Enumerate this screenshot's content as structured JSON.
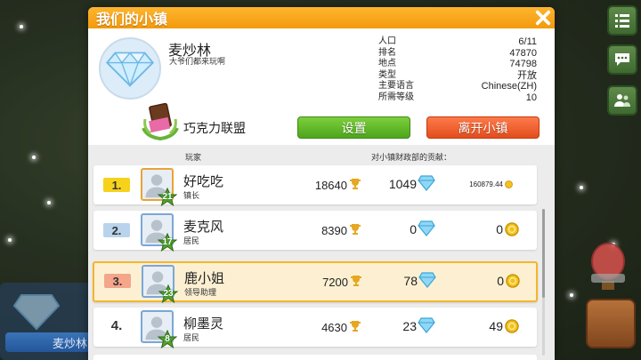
{
  "dialog": {
    "title": "我们的小镇"
  },
  "town": {
    "name": "麦炒林",
    "motto": "大爷们都来玩啊",
    "stats": [
      {
        "label": "人口",
        "value": "6/11"
      },
      {
        "label": "排名",
        "value": "47870"
      },
      {
        "label": "地点",
        "value": "74798"
      },
      {
        "label": "类型",
        "value": "开放"
      },
      {
        "label": "主要语言",
        "value": "Chinese(ZH)"
      },
      {
        "label": "所需等级",
        "value": "10"
      }
    ],
    "alliance": "巧克力联盟"
  },
  "buttons": {
    "settings": "设置",
    "leave": "离开小镇"
  },
  "list": {
    "header_player": "玩家",
    "header_contribution": "对小镇财政部的贡献："
  },
  "players": [
    {
      "rank": "1.",
      "name": "好吃吃",
      "role": "镇长",
      "level": "21",
      "trophies": "18640",
      "gems": "1049",
      "coins": "160879.44",
      "rank_color": "#f6d21b"
    },
    {
      "rank": "2.",
      "name": "麦克风",
      "role": "居民",
      "level": "17",
      "trophies": "8390",
      "gems": "0",
      "coins": "0",
      "rank_color": "#b9d3ec"
    },
    {
      "rank": "3.",
      "name": "鹿小姐",
      "role": "领导助理",
      "level": "23",
      "trophies": "7200",
      "gems": "78",
      "coins": "0",
      "rank_color": "#f4a58a"
    },
    {
      "rank": "4.",
      "name": "柳墨灵",
      "role": "居民",
      "level": "8",
      "trophies": "4630",
      "gems": "23",
      "coins": "49"
    }
  ],
  "background": {
    "town_label": "麦炒林"
  },
  "colors": {
    "title_orange": "#f29a0e",
    "settings_green": "#4ea51c",
    "leave_red": "#e24d1d",
    "selected_row": "#fdf0d2"
  }
}
